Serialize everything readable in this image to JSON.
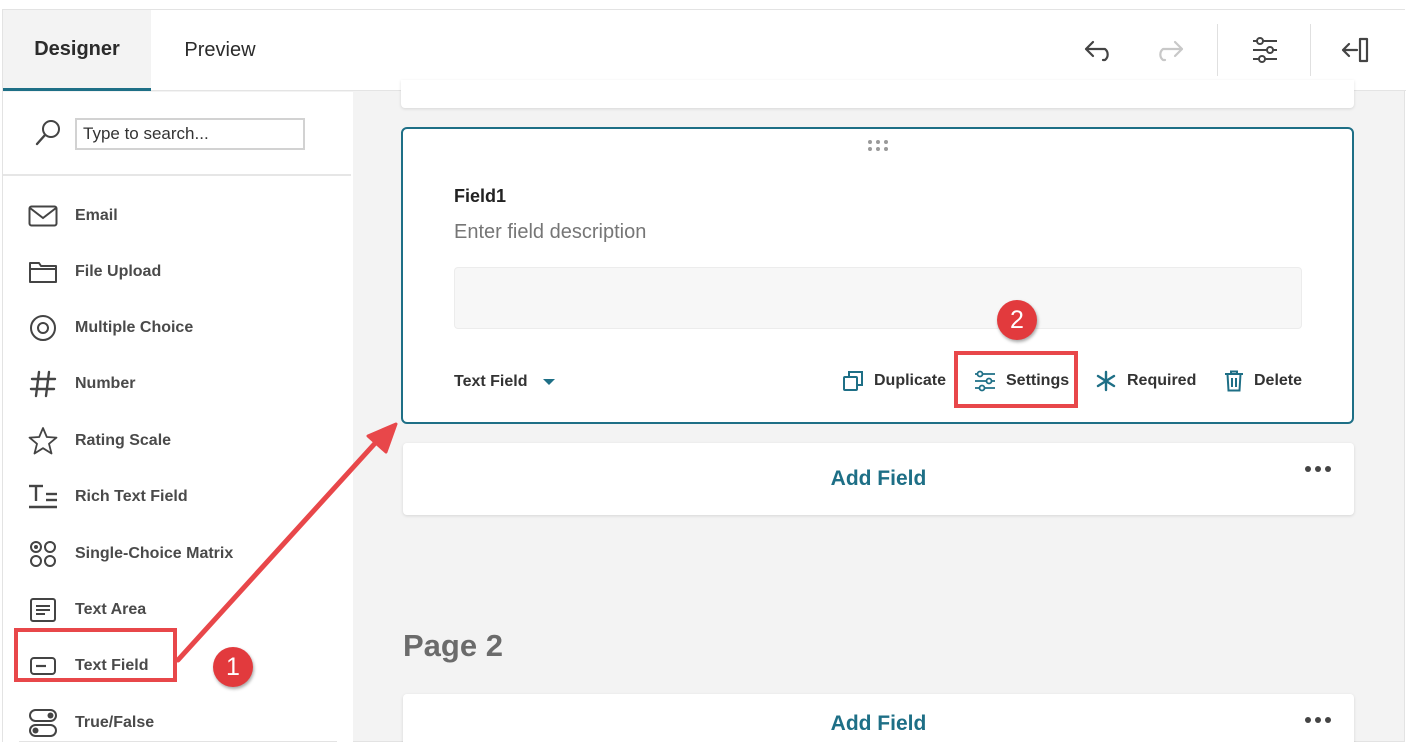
{
  "tabs": {
    "designer": "Designer",
    "preview": "Preview"
  },
  "toolbar": {
    "undo": "undo-icon",
    "redo": "redo-icon",
    "settings": "sliders-icon",
    "collapse": "collapse-panel-icon"
  },
  "search": {
    "placeholder": "Type to search..."
  },
  "toolbox": {
    "items": [
      {
        "label": "Email",
        "icon": "envelope-icon"
      },
      {
        "label": "File Upload",
        "icon": "folder-icon"
      },
      {
        "label": "Multiple Choice",
        "icon": "radio-icon"
      },
      {
        "label": "Number",
        "icon": "hash-icon"
      },
      {
        "label": "Rating Scale",
        "icon": "star-icon"
      },
      {
        "label": "Rich Text Field",
        "icon": "rich-text-icon"
      },
      {
        "label": "Single-Choice Matrix",
        "icon": "matrix-icon"
      },
      {
        "label": "Text Area",
        "icon": "text-area-icon"
      },
      {
        "label": "Text Field",
        "icon": "text-field-icon"
      },
      {
        "label": "True/False",
        "icon": "toggle-icon"
      }
    ]
  },
  "field": {
    "title": "Field1",
    "description_placeholder": "Enter field description",
    "type": "Text Field",
    "actions": {
      "duplicate": "Duplicate",
      "settings": "Settings",
      "required": "Required",
      "delete": "Delete"
    }
  },
  "add_field_label": "Add Field",
  "page2_title": "Page 2",
  "annotations": {
    "step1": "1",
    "step2": "2"
  },
  "colors": {
    "accent": "#1e6f86",
    "annotation": "#e8474a"
  }
}
